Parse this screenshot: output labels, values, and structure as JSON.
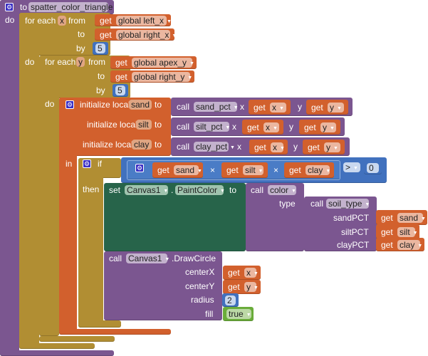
{
  "colors": {
    "procedure": "#7b5690",
    "loop": "#b18e33",
    "variable": "#d2602d",
    "math": "#4171be",
    "component_set": "#27644a",
    "logic": "#6aac3a"
  },
  "keywords": {
    "get": "get",
    "call": "call"
  },
  "procedure": {
    "to": "to",
    "name": "spatter_color_triangle",
    "do": "do"
  },
  "loop_x": {
    "for_each": "for each",
    "var": "x",
    "from": "from",
    "to": "to",
    "by": "by",
    "do": "do",
    "from_var": "global left_x",
    "to_var": "global right_x",
    "step": "5"
  },
  "loop_y": {
    "for_each": "for each",
    "var": "y",
    "from": "from",
    "to": "to",
    "by": "by",
    "do": "do",
    "from_var": "global apex_y",
    "to_var": "global right_y",
    "step": "5"
  },
  "locals": [
    {
      "label": "initialize local",
      "name": "sand",
      "to": "to",
      "proc": "sand_pct",
      "arg1": "x",
      "arg2": "y",
      "v1": "x",
      "v2": "y"
    },
    {
      "label": "initialize local",
      "name": "silt",
      "to": "to",
      "proc": "silt_pct",
      "arg1": "x",
      "arg2": "y",
      "v1": "x",
      "v2": "y"
    },
    {
      "label": "initialize local",
      "name": "clay",
      "to": "to",
      "proc": "clay_pct",
      "arg1": "x",
      "arg2": "y",
      "v1": "x",
      "v2": "y"
    }
  ],
  "local_in": "in",
  "if_block": {
    "label": "if",
    "then": "then",
    "operands": [
      "sand",
      "silt",
      "clay"
    ],
    "times": "×",
    "op": ">",
    "rhs": "0"
  },
  "set_block": {
    "set": "set",
    "component": "Canvas1",
    "dot": ".",
    "property": "PaintColor",
    "to": "to"
  },
  "color_call": {
    "proc": "color",
    "param": "type"
  },
  "soil_call": {
    "proc": "soil_type",
    "params": [
      "sandPCT",
      "siltPCT",
      "clayPCT"
    ],
    "values": [
      "sand",
      "silt",
      "clay"
    ]
  },
  "draw_call": {
    "component": "Canvas1",
    "method": ".DrawCircle",
    "params": [
      "centerX",
      "centerY",
      "radius",
      "fill"
    ],
    "centerX": "x",
    "centerY": "y",
    "radius": "2",
    "fill": "true"
  }
}
